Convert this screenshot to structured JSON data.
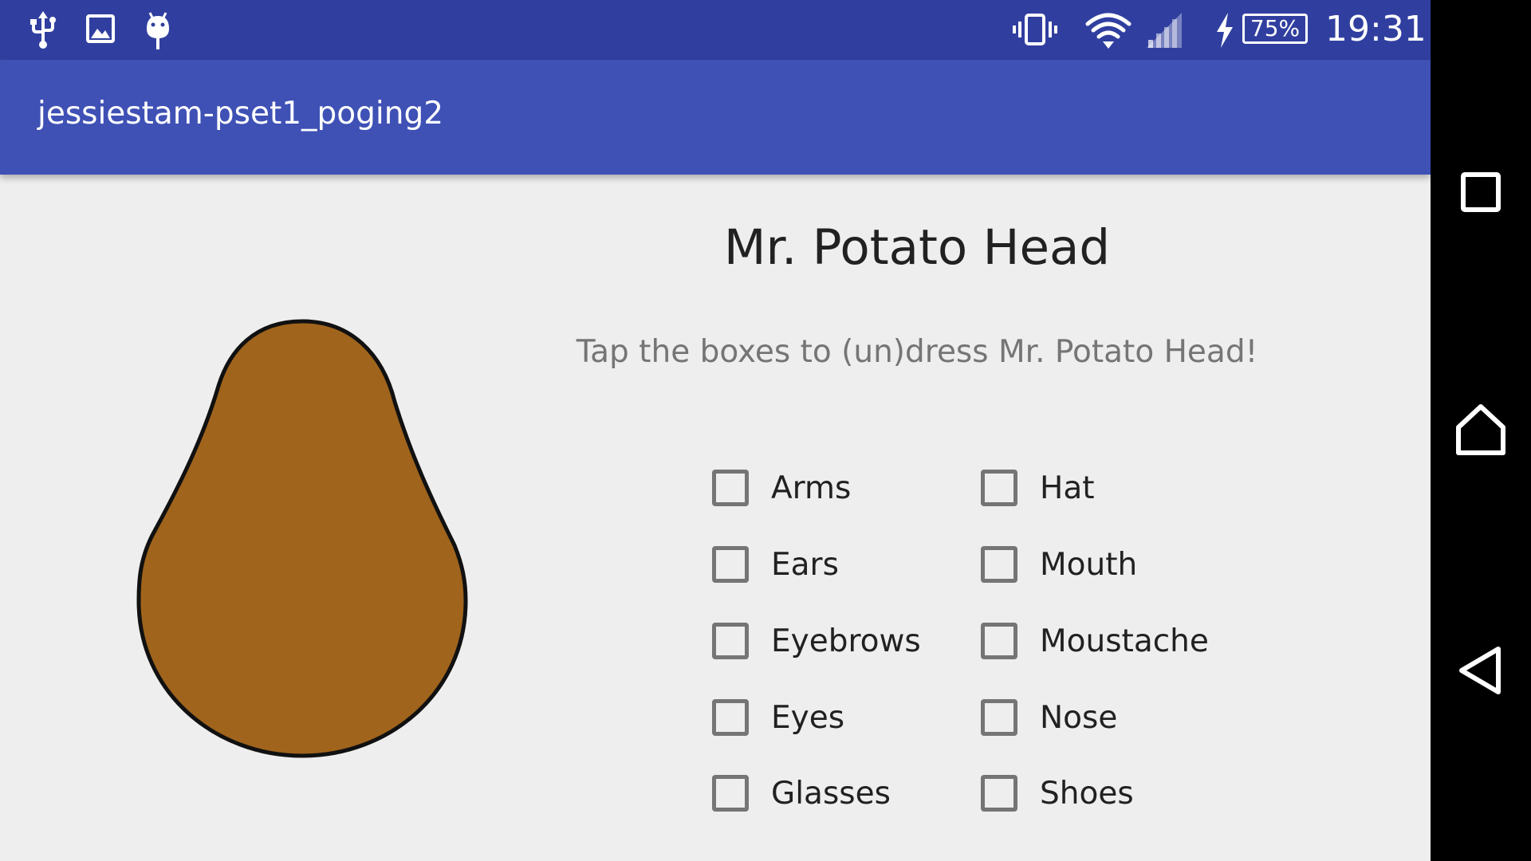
{
  "status_bar": {
    "left_icons": [
      "usb-icon",
      "image-icon",
      "android-debug-icon"
    ],
    "right_icons": [
      "vibrate-icon",
      "wifi-icon",
      "cell-signal-icon",
      "charging-icon"
    ],
    "battery": "75%",
    "time": "19:31"
  },
  "app": {
    "title": "jessiestam-pset1_poging2"
  },
  "main": {
    "title": "Mr. Potato Head",
    "subtitle": "Tap the boxes to (un)dress Mr. Potato Head!",
    "checkboxes_left": [
      {
        "label": "Arms",
        "checked": false
      },
      {
        "label": "Ears",
        "checked": false
      },
      {
        "label": "Eyebrows",
        "checked": false
      },
      {
        "label": "Eyes",
        "checked": false
      },
      {
        "label": "Glasses",
        "checked": false
      }
    ],
    "checkboxes_right": [
      {
        "label": "Hat",
        "checked": false
      },
      {
        "label": "Mouth",
        "checked": false
      },
      {
        "label": "Moustache",
        "checked": false
      },
      {
        "label": "Nose",
        "checked": false
      },
      {
        "label": "Shoes",
        "checked": false
      }
    ],
    "potato_color": "#a0641c"
  },
  "nav_bar": {
    "buttons": [
      "recents-icon",
      "home-icon",
      "back-icon"
    ]
  },
  "colors": {
    "status_bar": "#303f9f",
    "toolbar": "#3f51b5",
    "background": "#eeeeee"
  }
}
